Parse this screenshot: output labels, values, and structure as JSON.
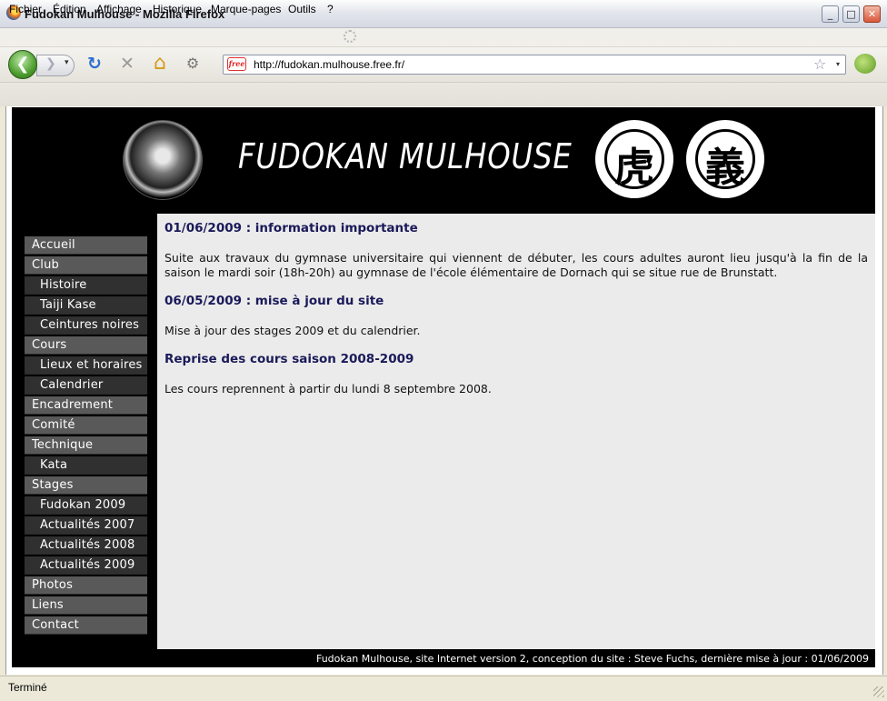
{
  "window": {
    "title": "Fudokan Mulhouse - Mozilla Firefox",
    "buttons": {
      "minimize": "_",
      "maximize": "□",
      "close": "✕"
    }
  },
  "menubar": {
    "items": [
      "Fichier",
      "Édition",
      "Affichage",
      "Historique",
      "Marque-pages",
      "Outils",
      "?"
    ]
  },
  "toolbar": {
    "back": "❮",
    "forward": "❯",
    "dropdown": "▾",
    "reload": "↻",
    "stop": "✕",
    "home": "⌂",
    "addon": "⚙",
    "favicon": "free",
    "url": "http://fudokan.mulhouse.free.fr/",
    "bookmark_star": "☆"
  },
  "site": {
    "title": "FUDOKAN MULHOUSE",
    "emblem1_glyph": "虎",
    "emblem2_glyph": "義",
    "tiger_glyph": "☗"
  },
  "sidebar": {
    "items": [
      {
        "label": "Accueil",
        "sub": false
      },
      {
        "label": "Club",
        "sub": false
      },
      {
        "label": "Histoire",
        "sub": true
      },
      {
        "label": "Taiji Kase",
        "sub": true
      },
      {
        "label": "Ceintures noires",
        "sub": true
      },
      {
        "label": "Cours",
        "sub": false
      },
      {
        "label": "Lieux et horaires",
        "sub": true
      },
      {
        "label": "Calendrier",
        "sub": true
      },
      {
        "label": "Encadrement",
        "sub": false
      },
      {
        "label": "Comité",
        "sub": false
      },
      {
        "label": "Technique",
        "sub": false
      },
      {
        "label": "Kata",
        "sub": true
      },
      {
        "label": "Stages",
        "sub": false
      },
      {
        "label": "Fudokan 2009",
        "sub": true
      },
      {
        "label": "Actualités 2007",
        "sub": true
      },
      {
        "label": "Actualités 2008",
        "sub": true
      },
      {
        "label": "Actualités 2009",
        "sub": true
      },
      {
        "label": "Photos",
        "sub": false
      },
      {
        "label": "Liens",
        "sub": false
      },
      {
        "label": "Contact",
        "sub": false
      }
    ]
  },
  "news": [
    {
      "title": "01/06/2009 : information importante",
      "body": "Suite aux travaux du gymnase universitaire qui viennent de débuter, les cours adultes auront lieu jusqu'à la fin de la saison le mardi soir (18h-20h) au gymnase de l'école élémentaire de Dornach qui se situe rue de Brunstatt."
    },
    {
      "title": "06/05/2009 : mise à jour du site",
      "body": "Mise à jour des stages 2009 et du calendrier."
    },
    {
      "title": "Reprise des cours saison 2008-2009",
      "body": "Les cours reprennent à partir du lundi 8 septembre 2008."
    }
  ],
  "footer": "Fudokan Mulhouse, site Internet version 2, conception du site : Steve Fuchs, dernière mise à jour : 01/06/2009",
  "status": "Terminé"
}
